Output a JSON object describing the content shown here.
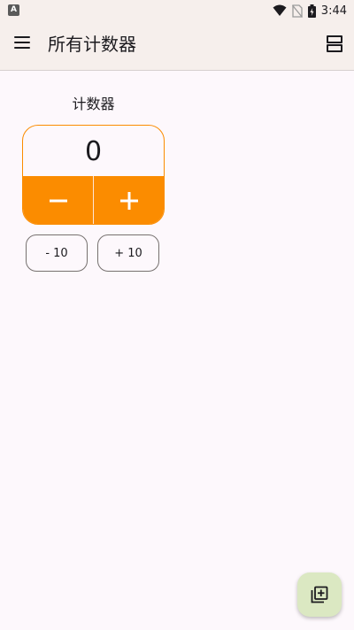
{
  "status_bar": {
    "app_icon": "a-letter-icon",
    "app_icon_text": "A",
    "time": "3:44",
    "icons": [
      "wifi-icon",
      "no-sim-icon",
      "battery-charging-icon"
    ]
  },
  "app_bar": {
    "title": "所有计数器",
    "menu_icon": "menu-icon",
    "layout_icon": "view-agenda-icon"
  },
  "counter": {
    "title": "计数器",
    "value": "0",
    "decrement_icon": "minus-icon",
    "increment_icon": "plus-icon",
    "accent_color": "#fb8c00"
  },
  "step_buttons": {
    "minus_ten": "- 10",
    "plus_ten": "+ 10"
  },
  "fab": {
    "icon": "add-to-collection-icon",
    "color": "#dbe8c2"
  }
}
